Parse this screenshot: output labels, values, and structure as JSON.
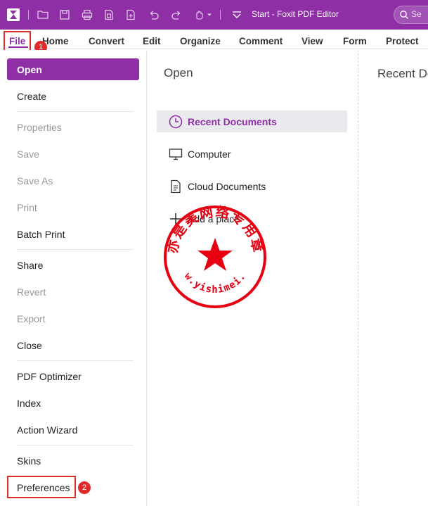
{
  "titlebar": {
    "title": "Start - Foxit PDF Editor",
    "search_placeholder": "Se"
  },
  "tabs": [
    "File",
    "Home",
    "Convert",
    "Edit",
    "Organize",
    "Comment",
    "View",
    "Form",
    "Protect"
  ],
  "annotations": {
    "badge1": "1",
    "badge2": "2"
  },
  "leftmenu": {
    "items": [
      {
        "label": "Open",
        "state": "active"
      },
      {
        "label": "Create",
        "state": "enabled"
      },
      {
        "label": "Properties",
        "state": "disabled"
      },
      {
        "label": "Save",
        "state": "disabled"
      },
      {
        "label": "Save As",
        "state": "disabled"
      },
      {
        "label": "Print",
        "state": "disabled"
      },
      {
        "label": "Batch Print",
        "state": "enabled"
      },
      {
        "label": "Share",
        "state": "enabled"
      },
      {
        "label": "Revert",
        "state": "disabled"
      },
      {
        "label": "Export",
        "state": "disabled"
      },
      {
        "label": "Close",
        "state": "enabled"
      },
      {
        "label": "PDF Optimizer",
        "state": "enabled"
      },
      {
        "label": "Index",
        "state": "enabled"
      },
      {
        "label": "Action Wizard",
        "state": "enabled"
      },
      {
        "label": "Skins",
        "state": "enabled"
      },
      {
        "label": "Preferences",
        "state": "enabled"
      }
    ]
  },
  "midpanel": {
    "title": "Open",
    "places": [
      {
        "label": "Recent Documents",
        "icon": "clock-icon",
        "selected": true
      },
      {
        "label": "Computer",
        "icon": "monitor-icon",
        "selected": false
      },
      {
        "label": "Cloud Documents",
        "icon": "document-icon",
        "selected": false
      },
      {
        "label": "Add a place",
        "icon": "plus-icon",
        "selected": false
      }
    ]
  },
  "rightpanel": {
    "title": "Recent Do"
  },
  "seal": {
    "text": "亦是美网络专用章",
    "url": "www.yishimei.cn"
  },
  "colors": {
    "accent": "#8e2fa6",
    "annotation": "#e02b2b",
    "seal": "#e60012"
  }
}
